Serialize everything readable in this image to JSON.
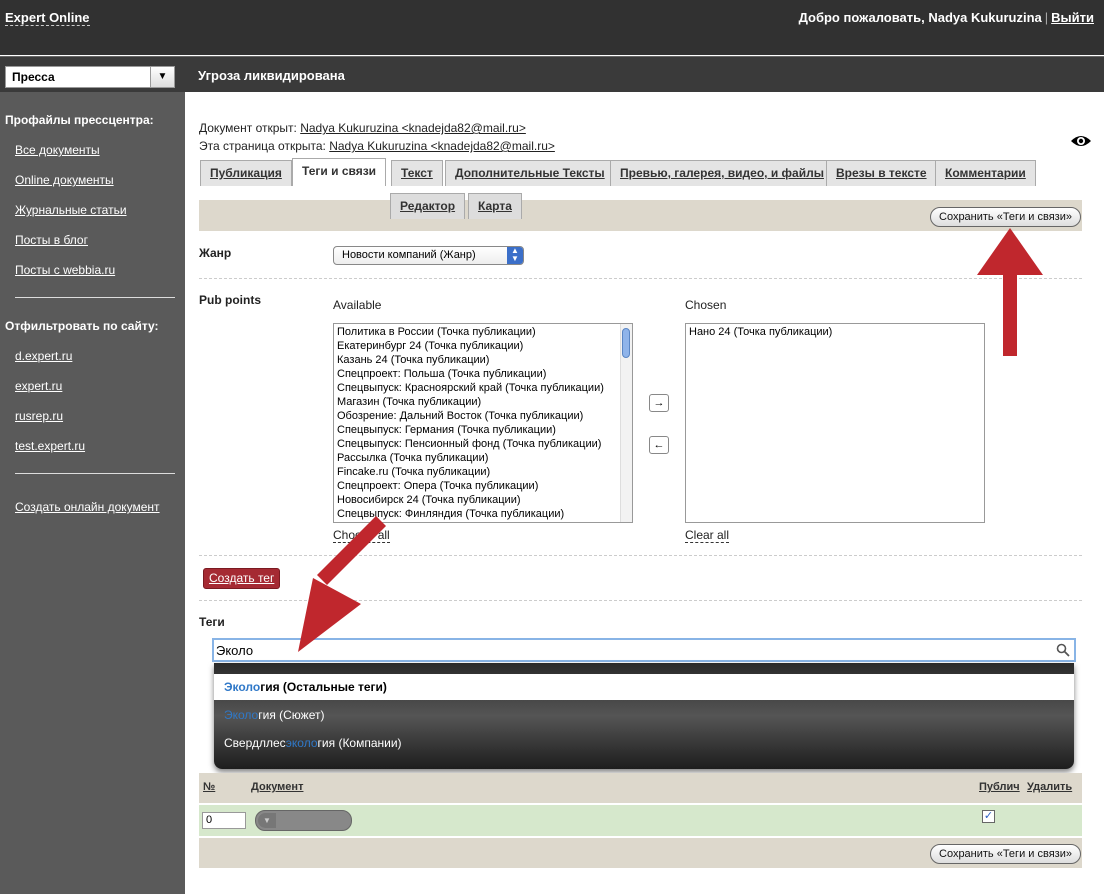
{
  "header": {
    "logo": "Expert Online",
    "welcome": "Добро пожаловать, Nadya Kukuruzina",
    "separator": "|",
    "logout": "Выйти"
  },
  "subbar": {
    "section_select": "Пресса",
    "document_title": "Угроза ликвидирована"
  },
  "sidebar": {
    "profiles_heading": "Профайлы прессцентра:",
    "profiles": [
      "Все документы",
      "Online документы",
      "Журнальные статьи",
      "Посты в блог",
      "Посты с webbia.ru"
    ],
    "filter_heading": "Отфильтровать по сайту:",
    "sites": [
      "d.expert.ru",
      "expert.ru",
      "rusrep.ru",
      "test.expert.ru"
    ],
    "create_online": "Создать онлайн документ"
  },
  "info": {
    "opened_by_label": "Документ открыт:",
    "opened_by_value": "Nadya Kukuruzina <knadejda82@mail.ru>",
    "page_opened_label": "Эта страница открыта:",
    "page_opened_value": "Nadya Kukuruzina <knadejda82@mail.ru>"
  },
  "tabs": [
    "Публикация",
    "Теги и связи",
    "Текст",
    "Дополнительные Тексты",
    "Превью, галерея, видео, и файлы",
    "Врезы в тексте",
    "Комментарии"
  ],
  "subtabs": [
    "Редактор",
    "Карта"
  ],
  "save_button": "Сохранить «Теги и связи»",
  "genre": {
    "label": "Жанр",
    "value": "Новости компаний (Жанр)"
  },
  "pub_points": {
    "label": "Pub points",
    "available_label": "Available",
    "chosen_label": "Chosen",
    "available": [
      "Политика в России (Точка публикации)",
      "Екатеринбург 24 (Точка публикации)",
      "Казань 24 (Точка публикации)",
      "Спецпроект: Польша (Точка публикации)",
      "Спецвыпуск: Красноярский край (Точка публикации)",
      "Магазин (Точка публикации)",
      "Обозрение: Дальний Восток (Точка публикации)",
      "Спецвыпуск: Германия (Точка публикации)",
      "Спецвыпуск: Пенсионный фонд (Точка публикации)",
      "Рассылка (Точка публикации)",
      "Fincake.ru (Точка публикации)",
      "Спецпроект: Опера (Точка публикации)",
      "Новосибирск 24 (Точка публикации)",
      "Спецвыпуск: Финляндия (Точка публикации)"
    ],
    "chosen": [
      "Нано 24 (Точка публикации)"
    ],
    "move_right": "→",
    "move_left": "←",
    "choose_all": "Choose all",
    "clear_all": "Clear all"
  },
  "create_tag_button": "Создать тег",
  "tags": {
    "label": "Теги",
    "input_value": "Эколо",
    "suggestions": [
      {
        "match": "Эколо",
        "rest": "гия (Остальные теги)",
        "prefix": ""
      },
      {
        "match": "Эколо",
        "rest": "гия (Сюжет)",
        "prefix": ""
      },
      {
        "prefix": "Свердллес",
        "match": "эколо",
        "rest": "гия (Компании)"
      }
    ]
  },
  "table": {
    "col_num": "№",
    "col_doc": "Документ",
    "col_pub": "Публич",
    "col_del": "Удалить",
    "row_num": "0"
  },
  "colors": {
    "topbar": "#313131",
    "sidebar": "#5a5a5a",
    "band": "#ddd8cc",
    "accent_red": "#a52a33",
    "row_green": "#d6e8cc",
    "arrow": "#c0272d"
  }
}
